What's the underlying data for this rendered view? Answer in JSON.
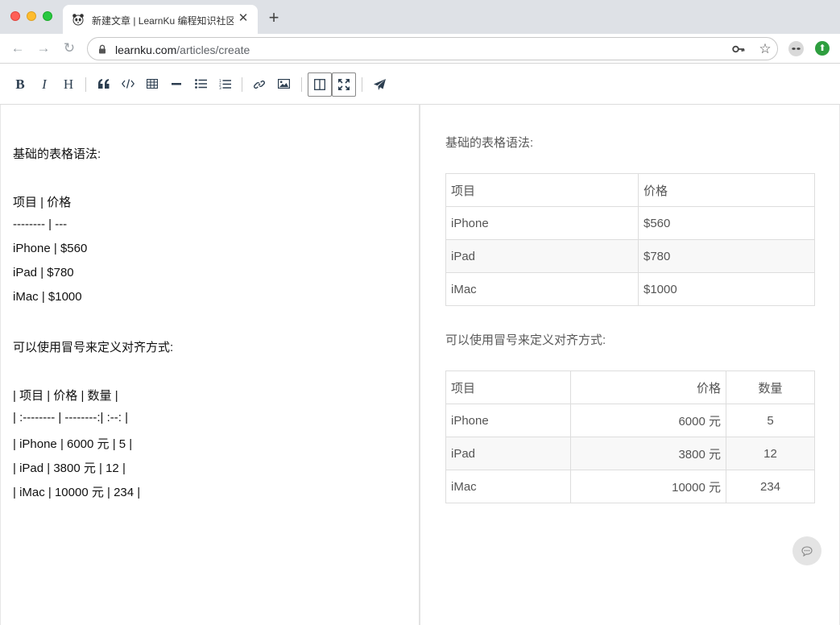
{
  "browser": {
    "tab_title": "新建文章 | LearnKu 编程知识社区",
    "tab_close": "✕",
    "new_tab": "+",
    "url_host": "learnku.com",
    "url_path": "/articles/create"
  },
  "toolbar": {
    "bold": "B",
    "italic": "I",
    "heading": "H"
  },
  "editor": {
    "lines": [
      "基础的表格语法:",
      "",
      "项目 | 价格",
      "-------- | ---",
      "iPhone | $560",
      "iPad | $780",
      "iMac | $1000",
      "",
      "可以使用冒号来定义对齐方式:",
      "",
      "| 项目 | 价格 | 数量 |",
      "| :-------- | --------:| :--: |",
      "| iPhone | 6000 元 | 5 |",
      "| iPad | 3800 元 | 12 |",
      "| iMac | 10000 元 | 234 |"
    ]
  },
  "preview": {
    "heading1": "基础的表格语法:",
    "table1": {
      "headers": [
        "项目",
        "价格"
      ],
      "rows": [
        [
          "iPhone",
          "$560"
        ],
        [
          "iPad",
          "$780"
        ],
        [
          "iMac",
          "$1000"
        ]
      ]
    },
    "heading2": "可以使用冒号来定义对齐方式:",
    "table2": {
      "headers": [
        "项目",
        "价格",
        "数量"
      ],
      "rows": [
        [
          "iPhone",
          "6000 元",
          "5"
        ],
        [
          "iPad",
          "3800 元",
          "12"
        ],
        [
          "iMac",
          "10000 元",
          "234"
        ]
      ]
    }
  },
  "colors": {
    "accent": "#2c3e50",
    "chrome": "#dee1e6"
  }
}
